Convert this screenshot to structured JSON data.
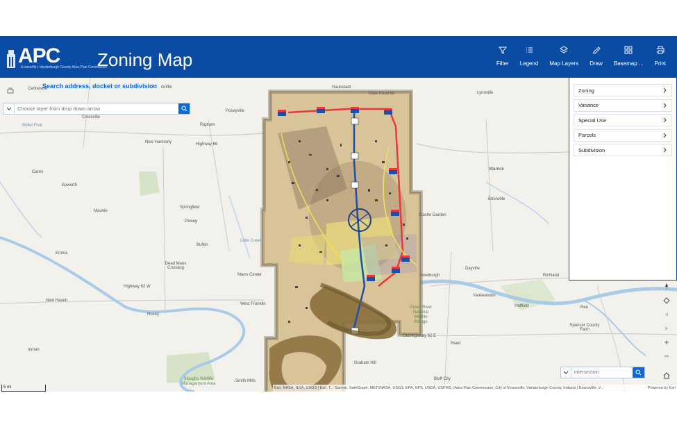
{
  "header": {
    "logo_text": "APC",
    "logo_sub": "Evansville | Vanderburgh County Area Plan Commission",
    "title": "Zoning Map",
    "tools": [
      {
        "label": "Filter",
        "icon": "filter-icon"
      },
      {
        "label": "Legend",
        "icon": "legend-icon"
      },
      {
        "label": "Map Layers",
        "icon": "layers-icon"
      },
      {
        "label": "Draw",
        "icon": "draw-icon"
      },
      {
        "label": "Basemap ...",
        "icon": "basemap-icon"
      },
      {
        "label": "Print",
        "icon": "print-icon"
      }
    ]
  },
  "search": {
    "label": "Search address, docket or subdivision",
    "placeholder": "Choose layer from drop down arrow"
  },
  "layer_panel": {
    "items": [
      "Zoning",
      "Variance",
      "Special Use",
      "Parcels",
      "Subdivision"
    ]
  },
  "intersection_search": {
    "placeholder": "intersection"
  },
  "map": {
    "scale": "5 mi",
    "attribution": "Esri, NASA, NGA, USGS | Esri, T... Garmin, SafeGraph, METI/NASA, USGS, EPA, NPS, USDA, USFWS | Area Plan Commission, City of Evansville, Vanderburgh County, Indiana | Evansville, V...",
    "powered_by": "Powered by Esri",
    "places": {
      "centerville": "Centerville",
      "griffin": "Griffin",
      "haubstadt": "Haubstadt",
      "state_road_68": "State Road 68",
      "lynnville": "Lynnville",
      "poseyville": "Poseyville",
      "crossville": "Crossville",
      "rapture": "Rapture",
      "skillet_fork": "Skillet Fork",
      "new_harmony": "New Harmony",
      "highway_66": "Highway 66",
      "carmi": "Carmi",
      "epworth": "Epworth",
      "warrick": "Warrick",
      "maunie": "Maunie",
      "springfield": "Springfield",
      "posey": "Posey",
      "boonville": "Boonville",
      "castle_garden": "Castle Garden",
      "bufkin": "Bufkin",
      "emma": "Emma",
      "dead_mans_crossing": "Dead Mans Crossing",
      "marrs_center": "Marrs Center",
      "newburgh": "Newburgh",
      "dayville": "Dayville",
      "richland": "Richland",
      "highway_62": "Highway 62 W",
      "new_haven": "New Haven",
      "west_franklin": "West Franklin",
      "yankeetown": "Yankeetown",
      "hatfield": "Hatfield",
      "reo": "Reo",
      "hovey": "Hovey",
      "green_river": "Green River National Wildlife Refuge",
      "spencer_county_farm": "Spencer County Farm",
      "old_highway": "Old Highway 62 E",
      "reed": "Reed",
      "inman": "Inman",
      "graham_hill": "Graham Hill",
      "bluff_city": "Bluff City",
      "smith_mills": "Smith Mills",
      "sloughs": "Sloughs Wildlife Management Area",
      "little_creek": "Little Creek"
    }
  },
  "colors": {
    "header_bg": "#0a4ba3",
    "accent": "#0a6ad8",
    "zoning_base": "#d9c49a",
    "river": "#a9cbe8"
  }
}
